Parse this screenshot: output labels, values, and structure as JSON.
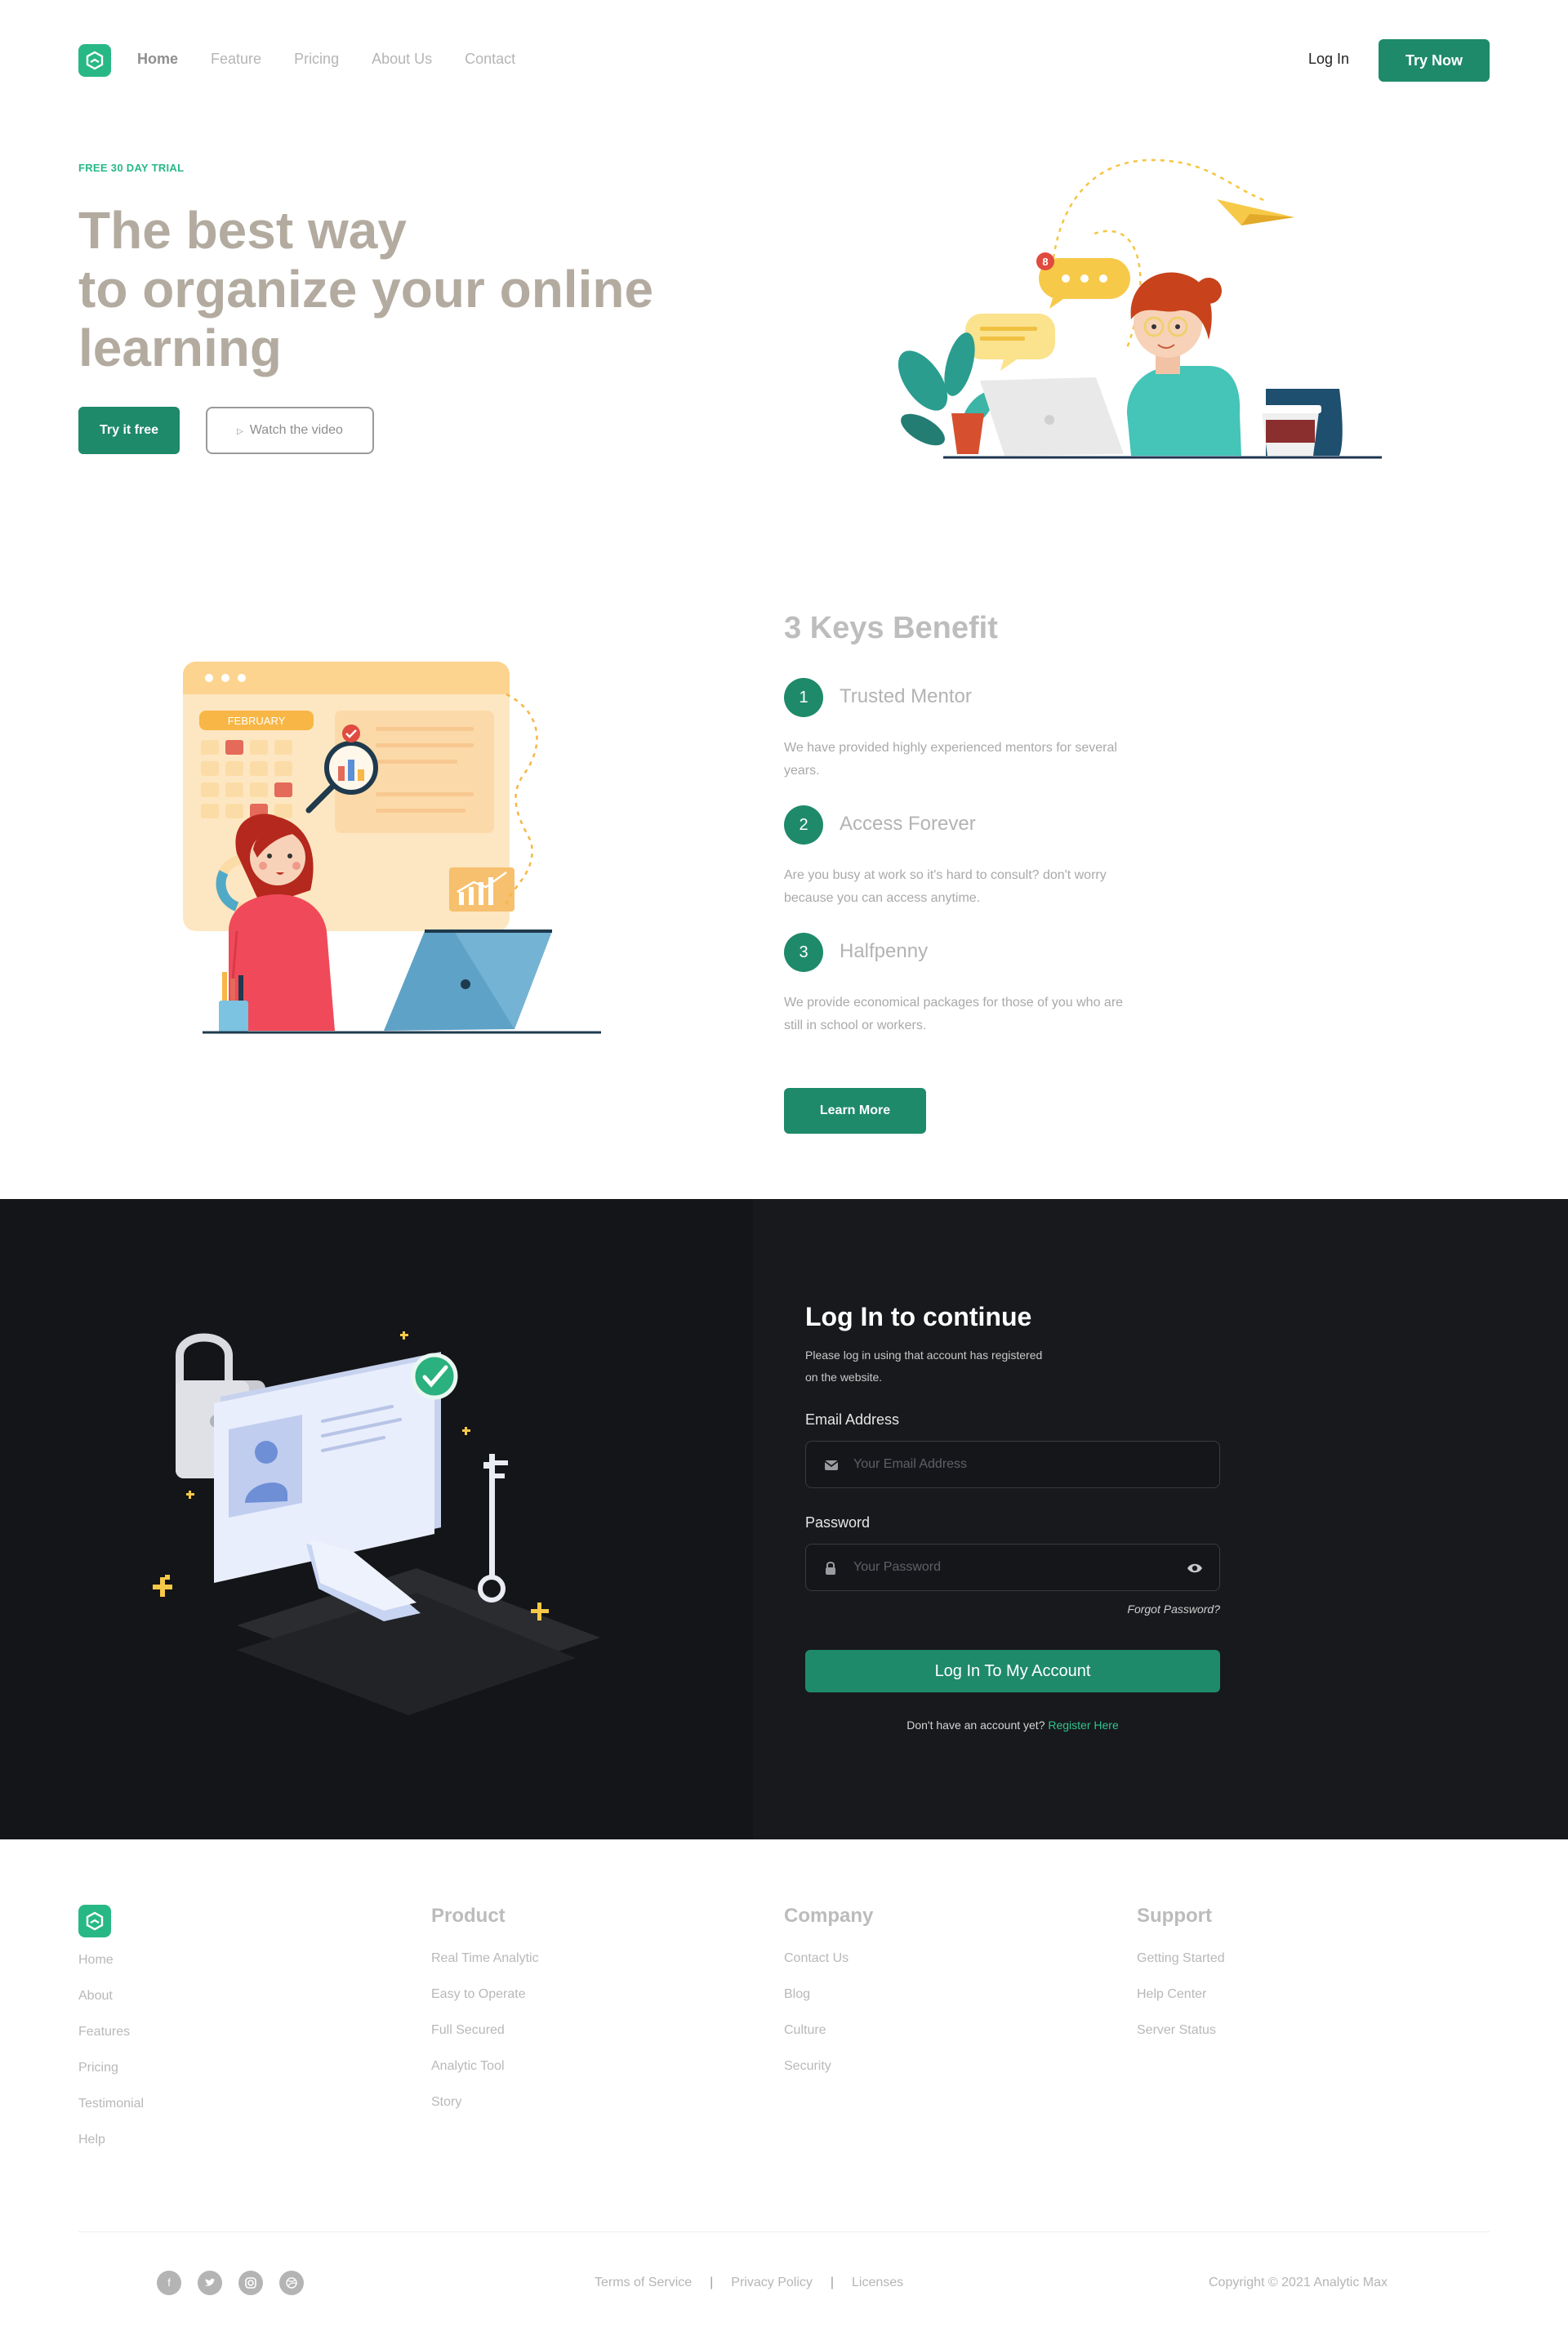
{
  "nav": {
    "links": [
      "Home",
      "Feature",
      "Pricing",
      "About Us",
      "Contact"
    ],
    "login": "Log In",
    "try_now": "Try Now"
  },
  "hero": {
    "eyebrow": "FREE 30 DAY TRIAL",
    "title_lines": [
      "The best way",
      "to organize your online",
      "learning"
    ],
    "try_free": "Try it free",
    "watch_video": "Watch the video",
    "notification_count": "8"
  },
  "benefits": {
    "title": "3 Keys Benefit",
    "calendar_month": "FEBRUARY",
    "items": [
      {
        "num": "1",
        "name": "Trusted Mentor",
        "desc": "We have provided highly experienced mentors for several years."
      },
      {
        "num": "2",
        "name": "Access Forever",
        "desc": "Are you busy at work so it's hard to consult? don't worry because you can access anytime."
      },
      {
        "num": "3",
        "name": "Halfpenny",
        "desc": "We provide economical packages for those of you who are still in school or workers."
      }
    ],
    "learn_more": "Learn More"
  },
  "login": {
    "title": "Log In to continue",
    "subtitle": "Please log in using that account has registered on the website.",
    "email_label": "Email Address",
    "email_placeholder": "Your Email Address",
    "password_label": "Password",
    "password_placeholder": "Your Password",
    "forgot": "Forgot Password?",
    "submit": "Log In To My Account",
    "no_account": "Don't have an account yet?",
    "register": "Register Here"
  },
  "footer": {
    "col0": [
      "Home",
      "About",
      "Features",
      "Pricing",
      "Testimonial",
      "Help"
    ],
    "product": {
      "title": "Product",
      "links": [
        "Real Time Analytic",
        "Easy to Operate",
        "Full Secured",
        "Analytic Tool",
        "Story"
      ]
    },
    "company": {
      "title": "Company",
      "links": [
        "Contact Us",
        "Blog",
        "Culture",
        "Security"
      ]
    },
    "support": {
      "title": "Support",
      "links": [
        "Getting Started",
        "Help Center",
        "Server Status"
      ]
    },
    "social_icons": [
      "facebook-icon",
      "twitter-icon",
      "instagram-icon",
      "dribbble-icon"
    ],
    "legal": [
      "Terms of Service",
      "Privacy Policy",
      "Licenses"
    ],
    "legal_separator": "|",
    "copyright": "Copyright © 2021 Analytic Max"
  },
  "colors": {
    "brand": "#1e8a6a",
    "brand_light": "#28b886",
    "dark_bg": "#141518",
    "hero_title": "#b3ab9f"
  }
}
